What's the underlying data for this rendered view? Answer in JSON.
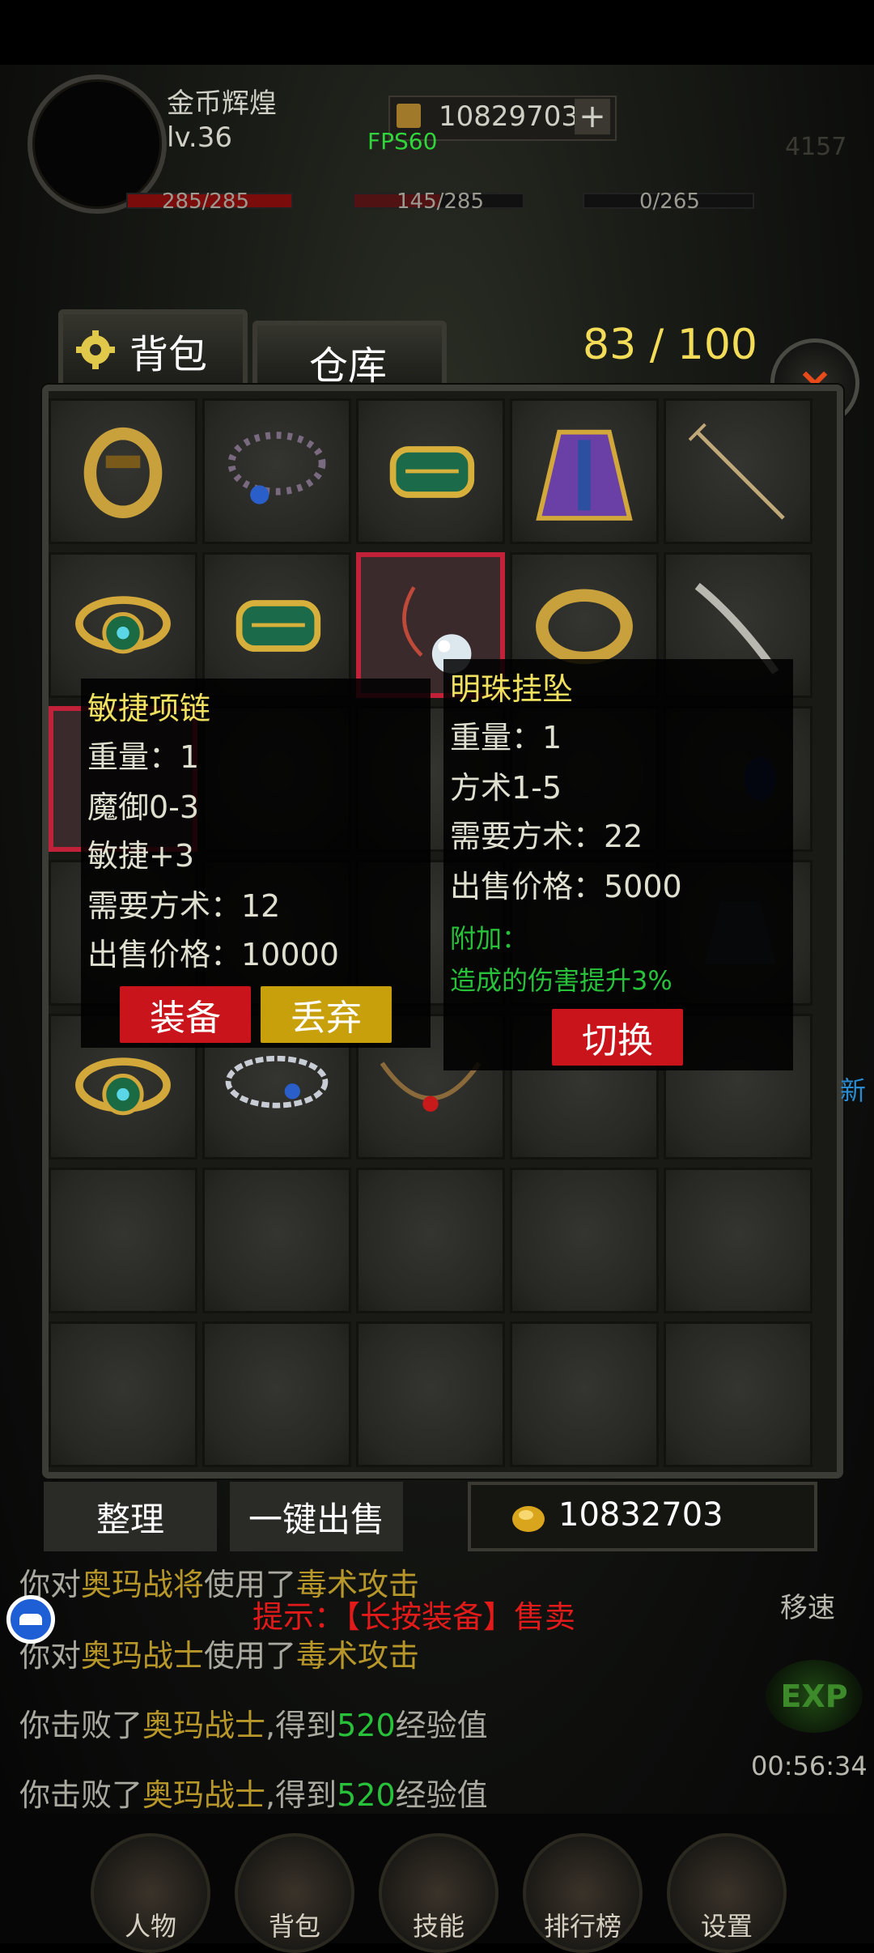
{
  "hud": {
    "player_name": "金币辉煌",
    "level": "lv.36",
    "gold_top": "10829703",
    "fps": "FPS60",
    "right_number": "4157",
    "hp": "285/285",
    "mp": "145/285",
    "exp_bar": "0/265"
  },
  "tabs": {
    "bag": "背包",
    "warehouse": "仓库"
  },
  "capacity": "83 / 100",
  "close_label": "×",
  "tooltip_left": {
    "name": "敏捷项链",
    "lines": [
      "重量：1",
      "魔御0-3",
      "敏捷+3",
      "需要方术：12",
      "出售价格：10000"
    ],
    "equip_label": "装备",
    "discard_label": "丢弃"
  },
  "tooltip_right": {
    "name": "明珠挂坠",
    "lines": [
      "重量：1",
      "方术1-5",
      "需要方术：22",
      "出售价格：5000"
    ],
    "extra_title": "附加：",
    "extra_text": "造成的伤害提升3%",
    "switch_label": "切换"
  },
  "actions": {
    "sort": "整理",
    "sell_all": "一键出售",
    "gold": "10832703"
  },
  "hint": "提示：【长按装备】售卖",
  "chat": [
    {
      "a": "你对",
      "b": "奥玛战将",
      "c": "使用了",
      "d": "毒术攻击",
      "e": ""
    },
    {
      "a": "你对",
      "b": "奥玛战士",
      "c": "使用了",
      "d": "毒术攻击",
      "e": ""
    },
    {
      "a": "你击败了",
      "b": "奥玛战士",
      "c": ",得到",
      "d": "520",
      "e": "经验值"
    },
    {
      "a": "你击败了",
      "b": "奥玛战士",
      "c": ",得到",
      "d": "520",
      "e": "经验值"
    }
  ],
  "side": {
    "speed": "移速",
    "exp_icon": "EXP",
    "timer": "00:56:34",
    "new": "新"
  },
  "nav": [
    "人物",
    "背包",
    "技能",
    "排行榜",
    "设置"
  ],
  "colors": {
    "gold_text": "#f2dc58",
    "tip_title": "#f0e060",
    "green": "#27c13a",
    "red_btn": "#c8141a",
    "gold_btn": "#c8a00c",
    "hint_red": "#e21a1a"
  },
  "items": [
    {
      "icon": "ring-icon"
    },
    {
      "icon": "bead-necklace-icon"
    },
    {
      "icon": "bracer-icon"
    },
    {
      "icon": "robe-armor-icon"
    },
    {
      "icon": "trident-icon"
    },
    {
      "icon": "jade-ring-icon"
    },
    {
      "icon": "bracer-icon"
    },
    {
      "icon": "pearl-pendant-icon"
    },
    {
      "icon": "gold-ring-icon"
    },
    {
      "icon": "saber-icon"
    },
    {
      "icon": "red-item-icon"
    },
    {
      "icon": "",
      "hidden": true
    },
    {
      "icon": "",
      "hidden": true
    },
    {
      "icon": "",
      "hidden": true
    },
    {
      "icon": "blue-gem-icon"
    },
    {
      "icon": "",
      "hidden": true
    },
    {
      "icon": "",
      "hidden": true
    },
    {
      "icon": "",
      "hidden": true
    },
    {
      "icon": "",
      "hidden": true
    },
    {
      "icon": "armor-icon"
    },
    {
      "icon": "jade-ring-icon"
    },
    {
      "icon": "chain-necklace-icon"
    },
    {
      "icon": "fang-necklace-icon"
    },
    {
      "icon": ""
    },
    {
      "icon": ""
    },
    {
      "icon": ""
    },
    {
      "icon": ""
    },
    {
      "icon": ""
    },
    {
      "icon": ""
    },
    {
      "icon": ""
    },
    {
      "icon": ""
    },
    {
      "icon": ""
    },
    {
      "icon": ""
    },
    {
      "icon": ""
    },
    {
      "icon": ""
    }
  ]
}
